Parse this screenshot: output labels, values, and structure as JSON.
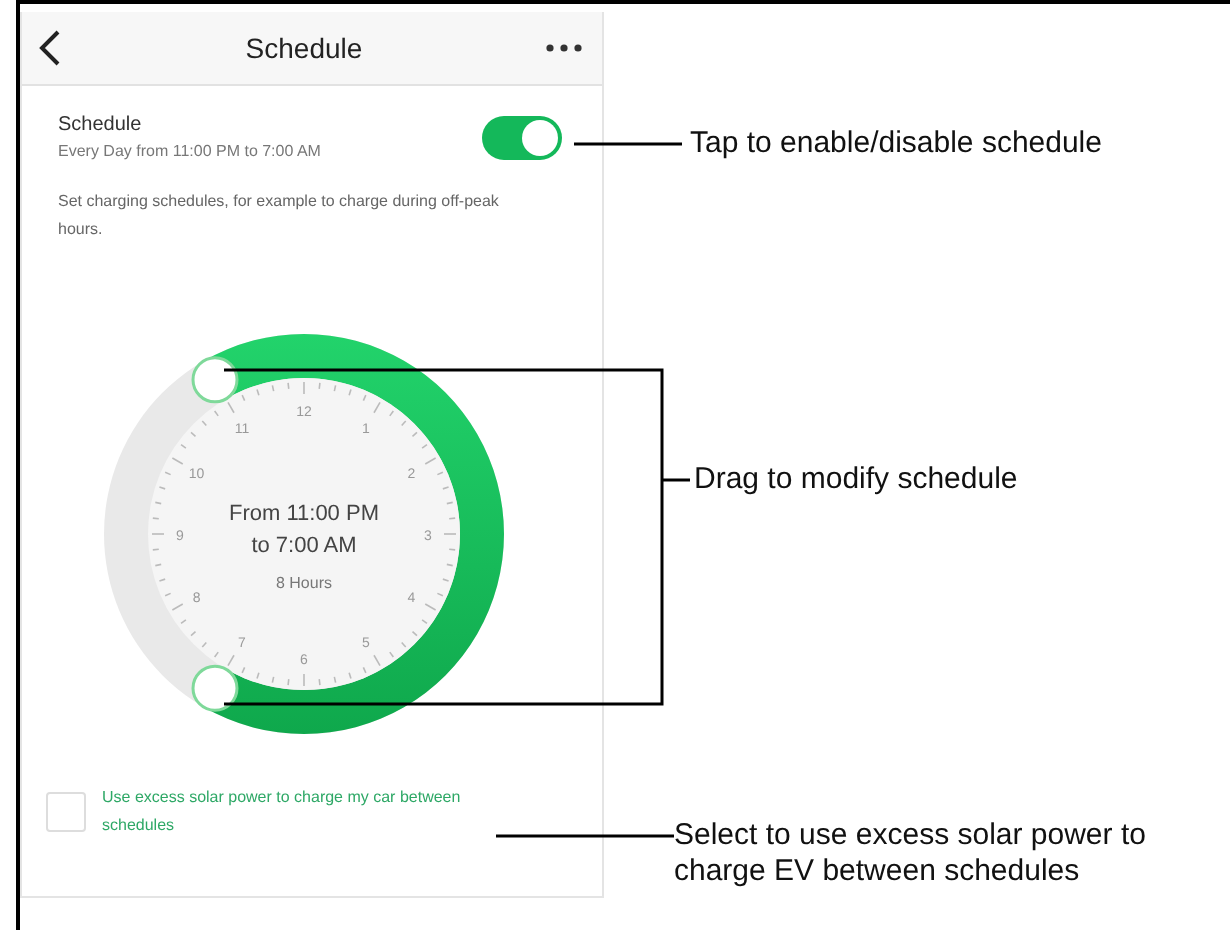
{
  "header": {
    "title": "Schedule"
  },
  "schedule": {
    "label": "Schedule",
    "summary": "Every Day from 11:00 PM to 7:00 AM",
    "on": true
  },
  "description": "Set charging schedules, for example to charge during off-peak hours.",
  "clock": {
    "range_line_1": "From 11:00 PM",
    "range_line_2": "to 7:00 AM",
    "duration": "8 Hours",
    "hour_labels": [
      "12",
      "1",
      "2",
      "3",
      "4",
      "5",
      "6",
      "7",
      "8",
      "9",
      "10",
      "11"
    ]
  },
  "solar_option": {
    "label": "Use excess solar power to charge my car between schedules",
    "checked": false
  },
  "annotations": [
    {
      "text": "Tap to enable/disable schedule"
    },
    {
      "text": "Drag to modify schedule"
    },
    {
      "text": "Select to use excess solar power to charge EV between schedules"
    }
  ]
}
